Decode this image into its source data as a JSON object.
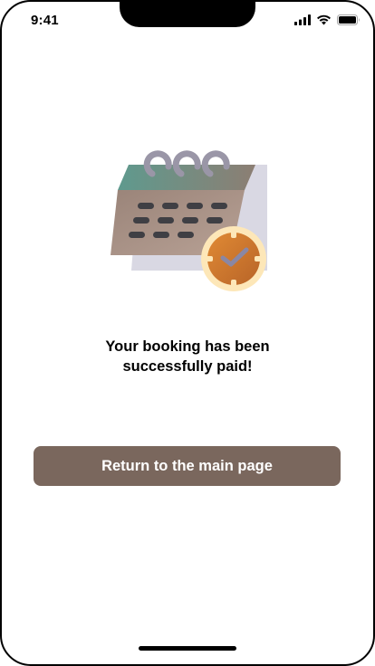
{
  "status_bar": {
    "time": "9:41",
    "icons": [
      "signal-icon",
      "wifi-icon",
      "battery-icon"
    ]
  },
  "illustration": {
    "name": "calendar-clock-illustration",
    "colors": {
      "calendar_top": "#6a9d93",
      "calendar_body": "#a68f84",
      "calendar_back": "#d7d6e0",
      "rings": "#9a96a7",
      "slots": "#3f3f44",
      "clock_face": "#d47a2f",
      "clock_rim": "#fde7b8",
      "clock_hand": "#8a87a4"
    }
  },
  "message": {
    "line1": "Your booking has been",
    "line2": "successfully paid!"
  },
  "actions": {
    "return_label": "Return to the main page",
    "button_color": "#7a675d"
  }
}
